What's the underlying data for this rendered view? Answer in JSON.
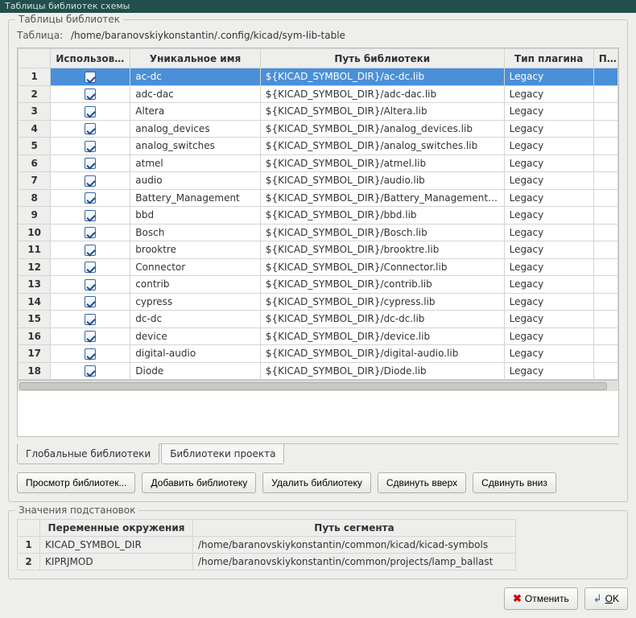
{
  "window": {
    "title": "Таблицы библиотек схемы"
  },
  "main_fieldset": {
    "label": "Таблицы библиотек"
  },
  "table_path": {
    "label": "Таблица:",
    "value": "/home/baranovskiykonstantin/.config/kicad/sym-lib-table"
  },
  "columns": {
    "use": "Использовать",
    "name": "Уникальное имя",
    "path": "Путь библиотеки",
    "type": "Тип плагина",
    "pa": "Па"
  },
  "rows": [
    {
      "n": "1",
      "name": "ac-dc",
      "path": "${KICAD_SYMBOL_DIR}/ac-dc.lib",
      "type": "Legacy",
      "sel": true
    },
    {
      "n": "2",
      "name": "adc-dac",
      "path": "${KICAD_SYMBOL_DIR}/adc-dac.lib",
      "type": "Legacy"
    },
    {
      "n": "3",
      "name": "Altera",
      "path": "${KICAD_SYMBOL_DIR}/Altera.lib",
      "type": "Legacy"
    },
    {
      "n": "4",
      "name": "analog_devices",
      "path": "${KICAD_SYMBOL_DIR}/analog_devices.lib",
      "type": "Legacy"
    },
    {
      "n": "5",
      "name": "analog_switches",
      "path": "${KICAD_SYMBOL_DIR}/analog_switches.lib",
      "type": "Legacy"
    },
    {
      "n": "6",
      "name": "atmel",
      "path": "${KICAD_SYMBOL_DIR}/atmel.lib",
      "type": "Legacy"
    },
    {
      "n": "7",
      "name": "audio",
      "path": "${KICAD_SYMBOL_DIR}/audio.lib",
      "type": "Legacy"
    },
    {
      "n": "8",
      "name": "Battery_Management",
      "path": "${KICAD_SYMBOL_DIR}/Battery_Management.lib",
      "type": "Legacy"
    },
    {
      "n": "9",
      "name": "bbd",
      "path": "${KICAD_SYMBOL_DIR}/bbd.lib",
      "type": "Legacy"
    },
    {
      "n": "10",
      "name": "Bosch",
      "path": "${KICAD_SYMBOL_DIR}/Bosch.lib",
      "type": "Legacy"
    },
    {
      "n": "11",
      "name": "brooktre",
      "path": "${KICAD_SYMBOL_DIR}/brooktre.lib",
      "type": "Legacy"
    },
    {
      "n": "12",
      "name": "Connector",
      "path": "${KICAD_SYMBOL_DIR}/Connector.lib",
      "type": "Legacy"
    },
    {
      "n": "13",
      "name": "contrib",
      "path": "${KICAD_SYMBOL_DIR}/contrib.lib",
      "type": "Legacy"
    },
    {
      "n": "14",
      "name": "cypress",
      "path": "${KICAD_SYMBOL_DIR}/cypress.lib",
      "type": "Legacy"
    },
    {
      "n": "15",
      "name": "dc-dc",
      "path": "${KICAD_SYMBOL_DIR}/dc-dc.lib",
      "type": "Legacy"
    },
    {
      "n": "16",
      "name": "device",
      "path": "${KICAD_SYMBOL_DIR}/device.lib",
      "type": "Legacy"
    },
    {
      "n": "17",
      "name": "digital-audio",
      "path": "${KICAD_SYMBOL_DIR}/digital-audio.lib",
      "type": "Legacy"
    },
    {
      "n": "18",
      "name": "Diode",
      "path": "${KICAD_SYMBOL_DIR}/Diode.lib",
      "type": "Legacy"
    }
  ],
  "tabs": {
    "global": "Глобальные библиотеки",
    "project": "Библиотеки проекта"
  },
  "buttons": {
    "browse": "Просмотр библиотек...",
    "add": "Добавить библиотеку",
    "remove": "Удалить библиотеку",
    "up": "Сдвинуть вверх",
    "down": "Сдвинуть вниз"
  },
  "subst": {
    "label": "Значения подстановок",
    "col_var": "Переменные окружения",
    "col_path": "Путь сегмента",
    "rows": [
      {
        "n": "1",
        "var": "KICAD_SYMBOL_DIR",
        "path": "/home/baranovskiykonstantin/common/kicad/kicad-symbols"
      },
      {
        "n": "2",
        "var": "KIPRJMOD",
        "path": "/home/baranovskiykonstantin/common/projects/lamp_ballast"
      }
    ]
  },
  "dialog": {
    "cancel": "Отменить",
    "ok": "OK",
    "ok_u": "O",
    "ok_rest": "K"
  }
}
